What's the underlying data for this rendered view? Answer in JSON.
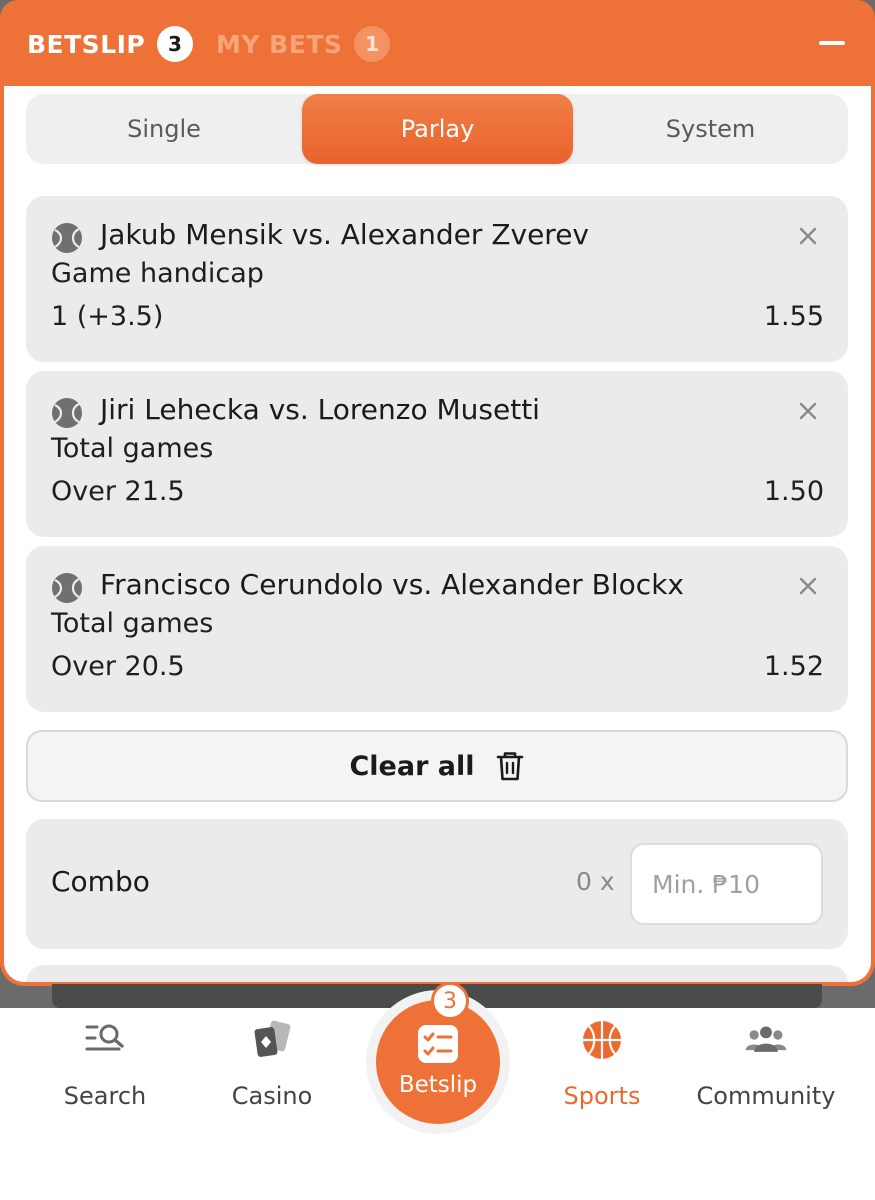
{
  "header": {
    "betslip_label": "BETSLIP",
    "betslip_count": "3",
    "mybets_label": "MY BETS",
    "mybets_count": "1"
  },
  "segments": {
    "single": "Single",
    "parlay": "Parlay",
    "system": "System",
    "active": "Parlay"
  },
  "bets": [
    {
      "match": "Jakub Mensik vs. Alexander Zverev",
      "market": "Game handicap",
      "selection": "1 (+3.5)",
      "odds": "1.55",
      "sport_icon": "tennis-ball-icon"
    },
    {
      "match": "Jiri Lehecka vs. Lorenzo Musetti",
      "market": "Total games",
      "selection": "Over 21.5",
      "odds": "1.50",
      "sport_icon": "tennis-ball-icon"
    },
    {
      "match": "Francisco Cerundolo vs. Alexander Blockx",
      "market": "Total games",
      "selection": "Over 20.5",
      "odds": "1.52",
      "sport_icon": "tennis-ball-icon"
    }
  ],
  "clear_all": "Clear all",
  "combo": {
    "label": "Combo",
    "multiplier": "0 x",
    "stake_placeholder": "Min. ₱10"
  },
  "bottom_nav": {
    "search": "Search",
    "casino": "Casino",
    "betslip": "Betslip",
    "betslip_badge": "3",
    "sports": "Sports",
    "community": "Community"
  },
  "colors": {
    "accent": "#ee7237",
    "card_bg": "#ebebeb",
    "muted_header": "#f6a47a"
  }
}
